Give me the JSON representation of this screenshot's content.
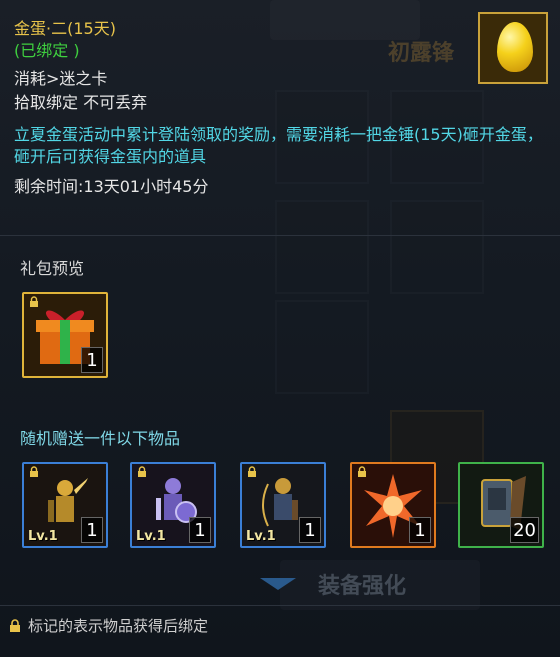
{
  "item": {
    "name": "金蛋·二(15天)",
    "bound": "(已绑定 )",
    "consume": "消耗>迷之卡",
    "pickup": "拾取绑定 不可丢弃",
    "description": "立夏金蛋活动中累计登陆领取的奖励，需要消耗一把金锤(15天)砸开金蛋，砸开后可获得金蛋内的道具",
    "remaining": "剩余时间:13天01小时45分",
    "icon": "golden-egg-icon"
  },
  "gift_preview": {
    "title": "礼包预览",
    "items": [
      {
        "icon": "gift-box-icon",
        "count": "1",
        "border": "#e0b43a"
      }
    ]
  },
  "random_gift": {
    "title": "随机赠送一件以下物品",
    "items": [
      {
        "icon": "gold-warrior-icon",
        "count": "1",
        "level": "Lv.1",
        "border": "#3b7fd6"
      },
      {
        "icon": "purple-knight-icon",
        "count": "1",
        "level": "Lv.1",
        "border": "#3b7fd6"
      },
      {
        "icon": "dark-archer-icon",
        "count": "1",
        "level": "Lv.1",
        "border": "#3b7fd6"
      },
      {
        "icon": "fire-star-icon",
        "count": "1",
        "border": "#e07a1f"
      },
      {
        "icon": "scroll-tablet-icon",
        "count": "20",
        "border": "#3fb24a"
      }
    ]
  },
  "footer": {
    "note": "标记的表示物品获得后绑定"
  },
  "background": {
    "top_text": "初露锋",
    "bottom_text": "装备强化"
  },
  "colors": {
    "title": "#e8c34a",
    "bound": "#3fcf3f",
    "description": "#52d7e6"
  }
}
